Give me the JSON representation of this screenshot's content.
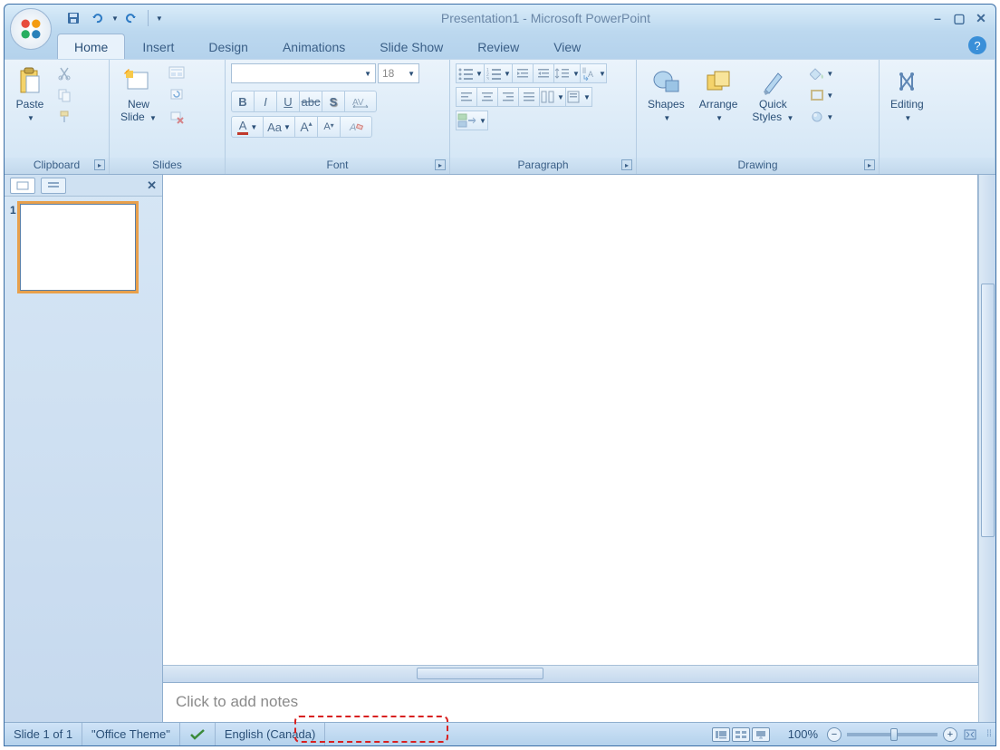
{
  "title": "Presentation1 - Microsoft PowerPoint",
  "tabs": [
    "Home",
    "Insert",
    "Design",
    "Animations",
    "Slide Show",
    "Review",
    "View"
  ],
  "active_tab": "Home",
  "ribbon": {
    "clipboard": {
      "label": "Clipboard",
      "paste": "Paste"
    },
    "slides": {
      "label": "Slides",
      "new_slide": "New\nSlide"
    },
    "font": {
      "label": "Font",
      "size": "18"
    },
    "paragraph": {
      "label": "Paragraph"
    },
    "drawing": {
      "label": "Drawing",
      "shapes": "Shapes",
      "arrange": "Arrange",
      "quick": "Quick\nStyles"
    },
    "editing": {
      "label": "Editing"
    }
  },
  "thumb": {
    "num": "1"
  },
  "notes_placeholder": "Click to add notes",
  "status": {
    "slide": "Slide 1 of 1",
    "theme": "\"Office Theme\"",
    "language": "English (Canada)",
    "zoom": "100%"
  }
}
